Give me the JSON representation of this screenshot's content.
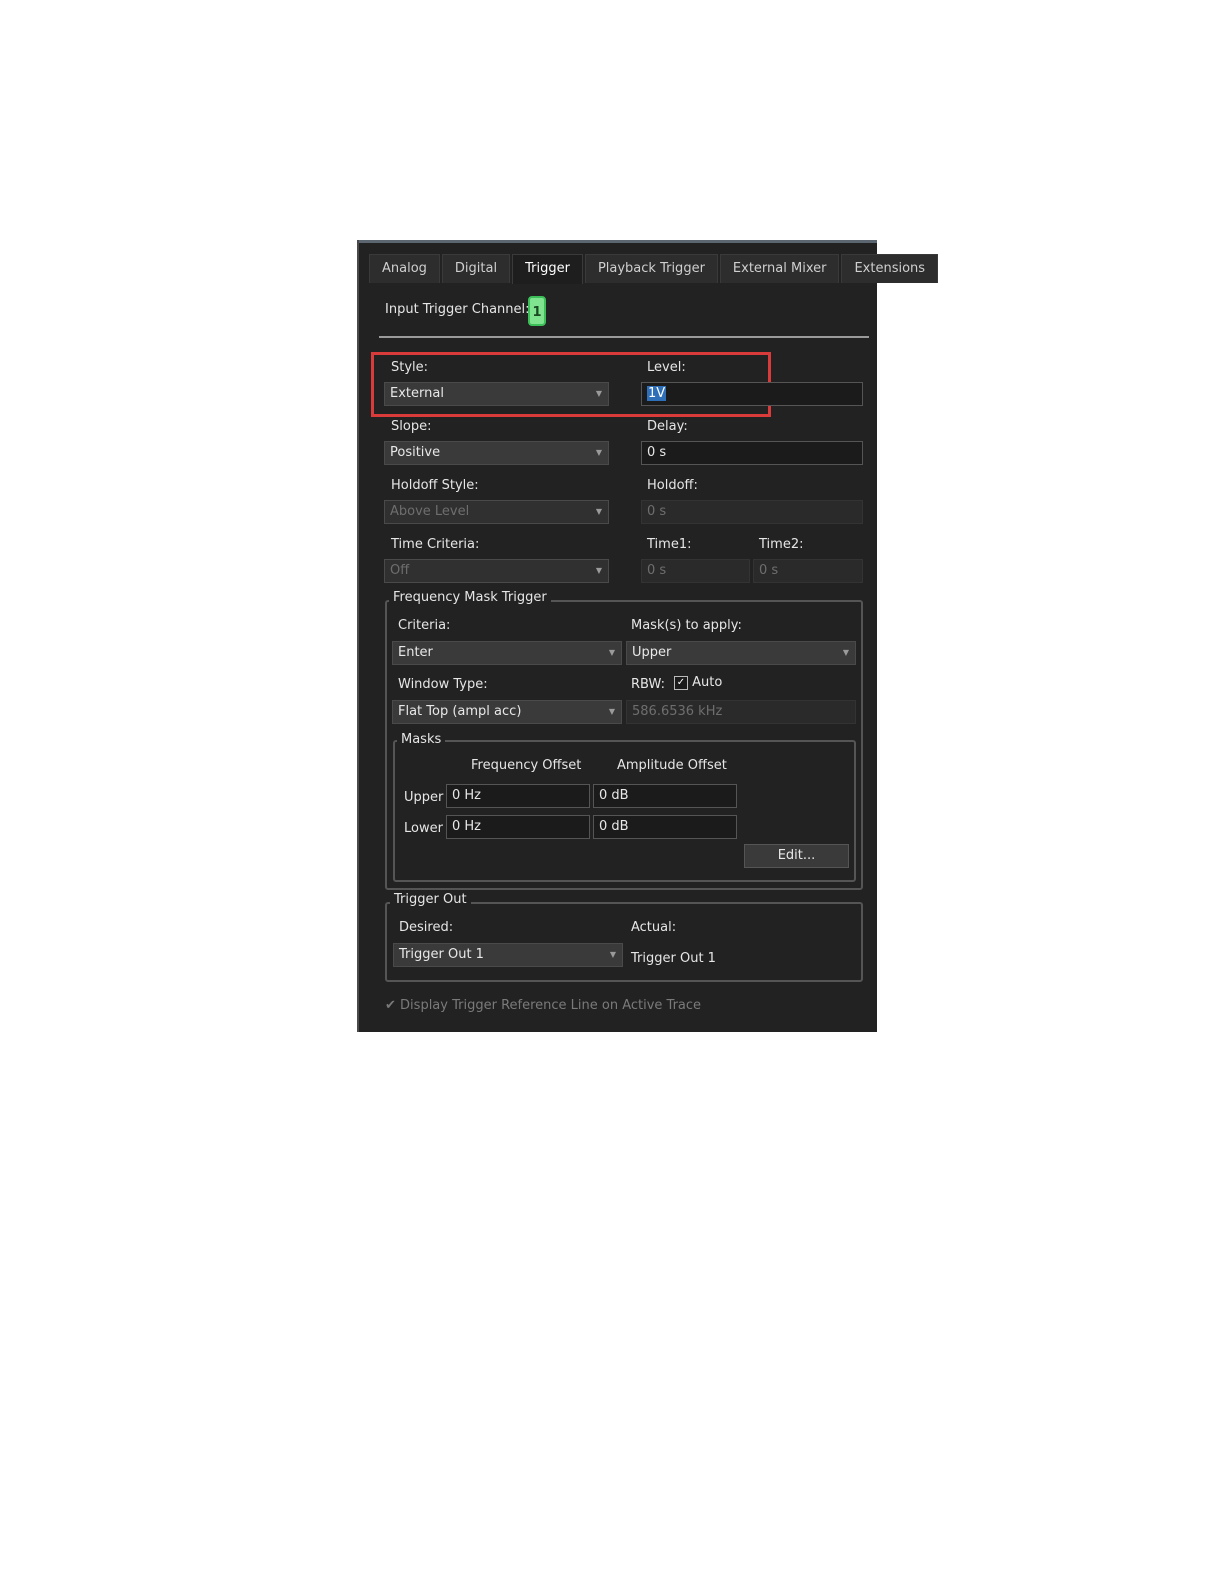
{
  "tabs": [
    "Analog",
    "Digital",
    "Trigger",
    "Playback Trigger",
    "External Mixer",
    "Extensions"
  ],
  "active_tab": "Trigger",
  "input_trigger": {
    "label": "Input Trigger Channel:",
    "channel": "1"
  },
  "style": {
    "label": "Style:",
    "value": "External"
  },
  "level": {
    "label": "Level:",
    "value": "1V"
  },
  "slope": {
    "label": "Slope:",
    "value": "Positive"
  },
  "delay": {
    "label": "Delay:",
    "value": "0 s"
  },
  "holdoff_style": {
    "label": "Holdoff Style:",
    "value": "Above Level"
  },
  "holdoff": {
    "label": "Holdoff:",
    "value": "0 s"
  },
  "time_criteria": {
    "label": "Time Criteria:",
    "value": "Off"
  },
  "time1": {
    "label": "Time1:",
    "value": "0 s"
  },
  "time2": {
    "label": "Time2:",
    "value": "0 s"
  },
  "fmt": {
    "title": "Frequency Mask Trigger",
    "criteria_label": "Criteria:",
    "criteria_value": "Enter",
    "masks_apply_label": "Mask(s) to apply:",
    "masks_apply_value": "Upper",
    "window_label": "Window Type:",
    "window_value": "Flat Top  (ampl acc)",
    "rbw_label": "RBW:",
    "rbw_auto_label": "Auto",
    "rbw_value": "586.6536 kHz"
  },
  "masks": {
    "title": "Masks",
    "col_freq": "Frequency Offset",
    "col_ampl": "Amplitude Offset",
    "rows": [
      {
        "label": "Upper",
        "freq": "0 Hz",
        "ampl": "0 dB"
      },
      {
        "label": "Lower",
        "freq": "0 Hz",
        "ampl": "0 dB"
      }
    ],
    "edit_label": "Edit..."
  },
  "trigger_out": {
    "title": "Trigger Out",
    "desired_label": "Desired:",
    "desired_value": "Trigger Out 1",
    "actual_label": "Actual:",
    "actual_value": "Trigger Out 1"
  },
  "display_ref": {
    "label": "Display Trigger Reference Line on Active Trace"
  }
}
